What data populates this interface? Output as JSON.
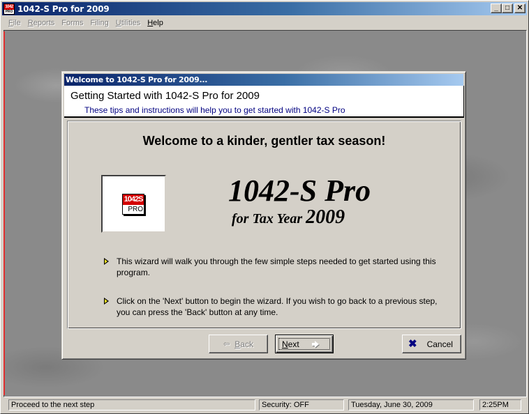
{
  "app": {
    "title": "1042-S Pro for 2009",
    "icon": "app-logo-icon",
    "icon_top_text": "1042",
    "icon_bottom_text": "PRO",
    "window_controls": {
      "minimize": "_",
      "maximize": "□",
      "close": "✕"
    }
  },
  "menubar": {
    "items": [
      {
        "label": "File",
        "accelerator": "F",
        "rest": "ile",
        "enabled": false
      },
      {
        "label": "Reports",
        "accelerator": "R",
        "rest": "eports",
        "enabled": false
      },
      {
        "label": "Forms",
        "accelerator": "",
        "rest": "Forms",
        "enabled": false
      },
      {
        "label": "Filing",
        "accelerator": "",
        "rest": "Filing",
        "enabled": false
      },
      {
        "label": "Utilities",
        "accelerator": "U",
        "rest": "tilities",
        "enabled": false
      },
      {
        "label": "Help",
        "accelerator": "H",
        "rest": "elp",
        "enabled": true
      }
    ]
  },
  "dialog": {
    "title": "Welcome to 1042-S Pro for 2009...",
    "heading": "Getting Started with 1042-S Pro for 2009",
    "subheading": "These tips and instructions will help you to get started with 1042-S Pro",
    "welcome_heading": "Welcome to a kinder, gentler tax season!",
    "logo": {
      "top_text": "1042S",
      "bottom_text": "PRO",
      "accent_color": "#d40000"
    },
    "product_title": "1042-S Pro",
    "product_sub_prefix": "for Tax Year",
    "product_sub_year": "2009",
    "tips": [
      {
        "icon": "yellow-arrow-bullet-icon",
        "text": "This wizard will walk you through the few simple steps needed to get started using this program."
      },
      {
        "icon": "yellow-arrow-bullet-icon",
        "text": "Click on the 'Next' button to begin the wizard.  If you wish to go back to a previous step, you can press the 'Back' button at any time."
      }
    ],
    "buttons": {
      "back": {
        "accel": "B",
        "rest": "ack",
        "enabled": false
      },
      "next": {
        "accel": "N",
        "rest": "ext",
        "enabled": true
      },
      "cancel": {
        "label": "Cancel",
        "icon": "cancel-x-icon",
        "icon_color": "#000080"
      }
    }
  },
  "statusbar": {
    "message": "Proceed to the next step",
    "security": "Security: OFF",
    "date": "Tuesday, June 30, 2009",
    "time": "2:25PM"
  }
}
